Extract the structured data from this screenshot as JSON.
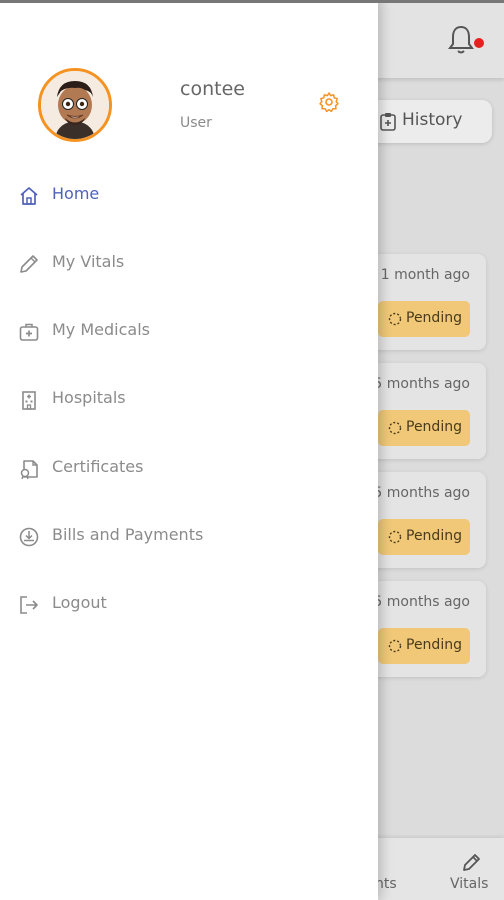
{
  "user": {
    "name": "contee",
    "role": "User"
  },
  "menu": [
    {
      "label": "Home",
      "icon": "home-icon",
      "active": true
    },
    {
      "label": "My Vitals",
      "icon": "pen-icon",
      "active": false
    },
    {
      "label": "My Medicals",
      "icon": "medical-kit-icon",
      "active": false
    },
    {
      "label": "Hospitals",
      "icon": "hospital-icon",
      "active": false
    },
    {
      "label": "Certificates",
      "icon": "certificate-icon",
      "active": false
    },
    {
      "label": "Bills and Payments",
      "icon": "bill-icon",
      "active": false
    },
    {
      "label": "Logout",
      "icon": "logout-icon",
      "active": false
    }
  ],
  "background": {
    "history_label": "History",
    "records": [
      {
        "time": "1 month ago",
        "status": "Pending"
      },
      {
        "time": "5 months ago",
        "status": "Pending"
      },
      {
        "time": "5 months ago",
        "status": "Pending"
      },
      {
        "time": "5 months ago",
        "status": "Pending"
      }
    ],
    "bottom_nav": {
      "partial_label": "nts",
      "vitals_label": "Vitals"
    }
  },
  "colors": {
    "accent_orange": "#f59322",
    "active_blue": "#4f62b8",
    "pending_badge": "#f0c878",
    "notification_dot": "#e81f1f"
  }
}
